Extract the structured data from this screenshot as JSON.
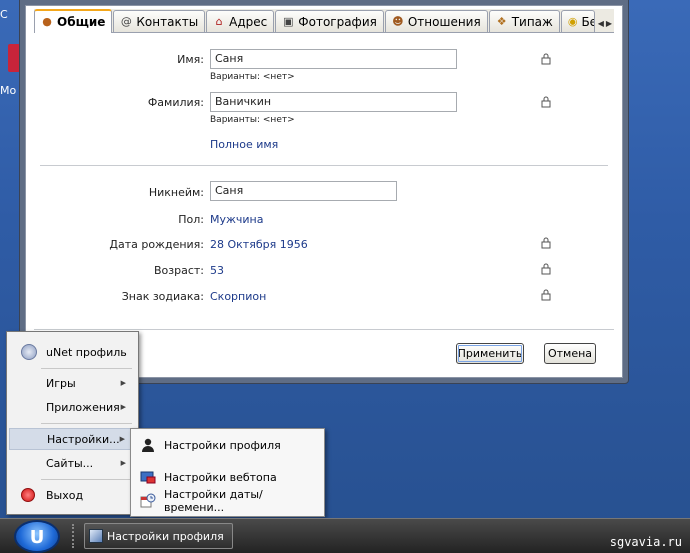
{
  "desktop": {
    "icon_label_top": "С",
    "icon_label": "Mo"
  },
  "tabs": [
    {
      "label": "Общие",
      "icon": "person-icon",
      "active": true
    },
    {
      "label": "Контакты",
      "icon": "at-icon"
    },
    {
      "label": "Адрес",
      "icon": "house-icon"
    },
    {
      "label": "Фотография",
      "icon": "camera-icon"
    },
    {
      "label": "Отношения",
      "icon": "people-icon"
    },
    {
      "label": "Типаж",
      "icon": "tag-icon"
    },
    {
      "label": "Безопасность",
      "icon": "lock-icon"
    }
  ],
  "form": {
    "first_name_label": "Имя:",
    "first_name_value": "Саня",
    "first_name_variants": "Варианты: <нет>",
    "last_name_label": "Фамилия:",
    "last_name_value": "Ваничкин",
    "last_name_variants": "Варианты: <нет>",
    "full_name_link": "Полное имя",
    "nickname_label": "Никнейм:",
    "nickname_value": "Саня",
    "gender_label": "Пол:",
    "gender_value": "Мужчина",
    "birthdate_label": "Дата рождения:",
    "birthdate_value": "28 Октября 1956",
    "age_label": "Возраст:",
    "age_value": "53",
    "zodiac_label": "Знак зодиака:",
    "zodiac_value": "Скорпион"
  },
  "buttons": {
    "apply": "Применить",
    "cancel": "Отмена"
  },
  "start_menu": {
    "profile": "uNet профиль",
    "games": "Игры",
    "apps": "Приложения",
    "settings": "Настройки...",
    "sites": "Сайты...",
    "exit": "Выход"
  },
  "submenu": {
    "profile_settings": "Настройки профиля",
    "webtop_settings": "Настройки вебтопа",
    "datetime_settings": "Настройки даты/времени..."
  },
  "taskbar": {
    "start_label": "U",
    "task_label": "Настройки профиля",
    "watermark": "sgvavia.ru"
  }
}
